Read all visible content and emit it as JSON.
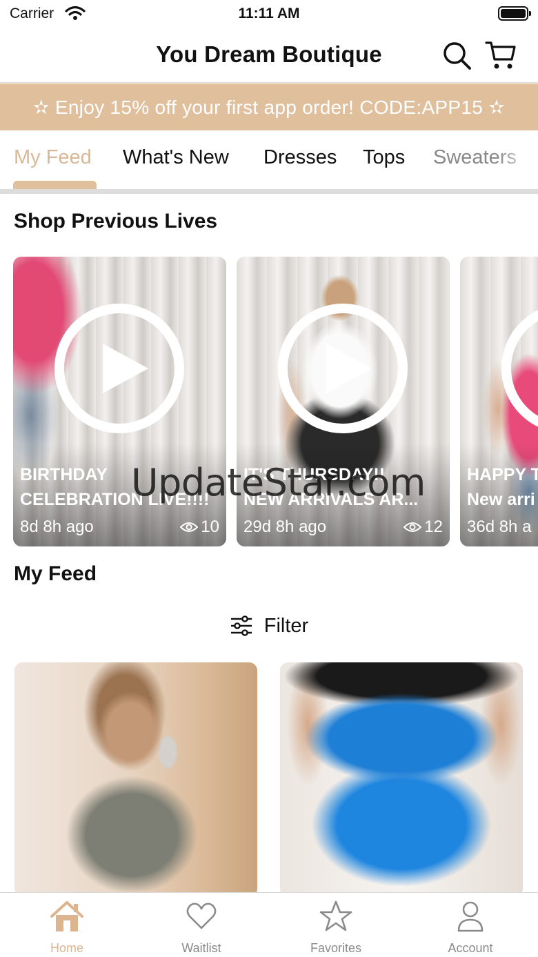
{
  "status_bar": {
    "carrier": "Carrier",
    "time": "11:11 AM"
  },
  "header": {
    "title": "You Dream Boutique",
    "icons": [
      "search-icon",
      "cart-icon"
    ]
  },
  "promo": {
    "text": "✫ Enjoy 15% off your first app order! CODE:APP15 ✫"
  },
  "tabs": [
    {
      "label": "My Feed",
      "active": true
    },
    {
      "label": "What's New"
    },
    {
      "label": "Dresses"
    },
    {
      "label": "Tops"
    },
    {
      "label": "Sweaters"
    }
  ],
  "lives": {
    "title": "Shop Previous Lives",
    "items": [
      {
        "line1": "BIRTHDAY",
        "line2": "CELEBRATION LIVE!!!!",
        "ago": "8d 8h ago",
        "views": "10"
      },
      {
        "line1": "IT'S THURSDAY!!",
        "line2": "NEW ARRIVALS AR...",
        "ago": "29d 8h ago",
        "views": "12"
      },
      {
        "line1": "HAPPY T",
        "line2": "New arri",
        "ago": "36d 8h a",
        "views": ""
      }
    ]
  },
  "feed": {
    "title": "My Feed",
    "filter_label": "Filter"
  },
  "watermark": "UpdateStar.com",
  "bottom_nav": [
    {
      "label": "Home",
      "icon": "home-icon",
      "active": true
    },
    {
      "label": "Waitlist",
      "icon": "heart-icon"
    },
    {
      "label": "Favorites",
      "icon": "star-icon"
    },
    {
      "label": "Account",
      "icon": "person-icon"
    }
  ],
  "colors": {
    "accent": "#dfbf9c",
    "active_tab": "#d7b898",
    "nav_inactive": "#8a8a8a"
  }
}
